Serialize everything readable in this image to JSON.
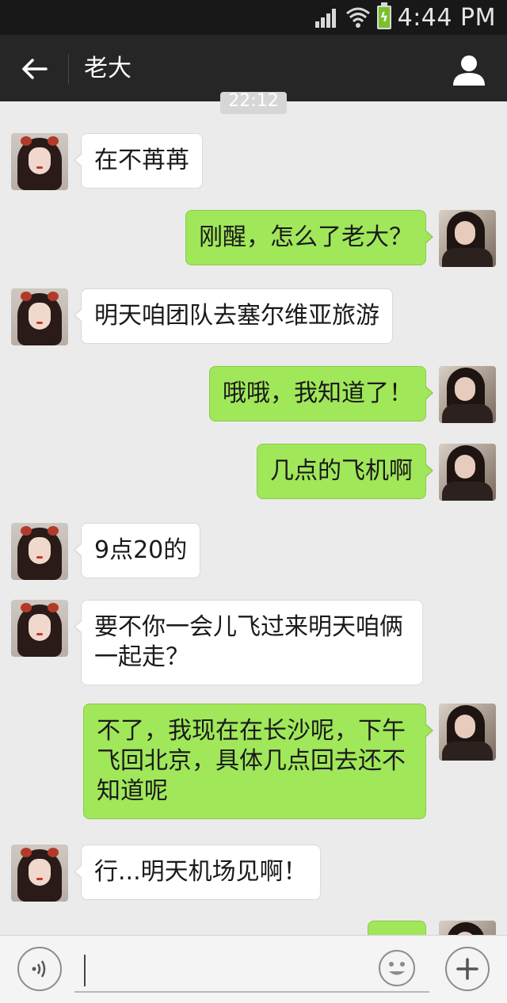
{
  "status_bar": {
    "time": "4:44 PM"
  },
  "header": {
    "title": "老大"
  },
  "timestamp": "22:12",
  "messages": [
    {
      "side": "in",
      "text": "在不苒苒"
    },
    {
      "side": "out",
      "text": "刚醒，怎么了老大？"
    },
    {
      "side": "in",
      "text": "明天咱团队去塞尔维亚旅游"
    },
    {
      "side": "out",
      "text": "哦哦，我知道了！"
    },
    {
      "side": "out",
      "text": "几点的飞机啊"
    },
    {
      "side": "in",
      "text": "9点20的"
    },
    {
      "side": "in",
      "text": "要不你一会儿飞过来明天咱俩一起走？"
    },
    {
      "side": "out",
      "text": "不了，我现在在长沙呢，下午飞回北京，具体几点回去还不知道呢"
    },
    {
      "side": "in",
      "text": "行...明天机场见啊！"
    },
    {
      "side": "out",
      "text": ""
    }
  ],
  "input": {
    "placeholder": ""
  },
  "icons": {
    "back": "arrow-left-icon",
    "profile": "person-icon",
    "voice": "voice-icon",
    "emoji": "smiley-icon",
    "more": "plus-icon"
  },
  "colors": {
    "header_bg": "#262626",
    "chat_bg": "#ebebeb",
    "outgoing_bubble": "#a0e75a",
    "incoming_bubble": "#ffffff"
  }
}
